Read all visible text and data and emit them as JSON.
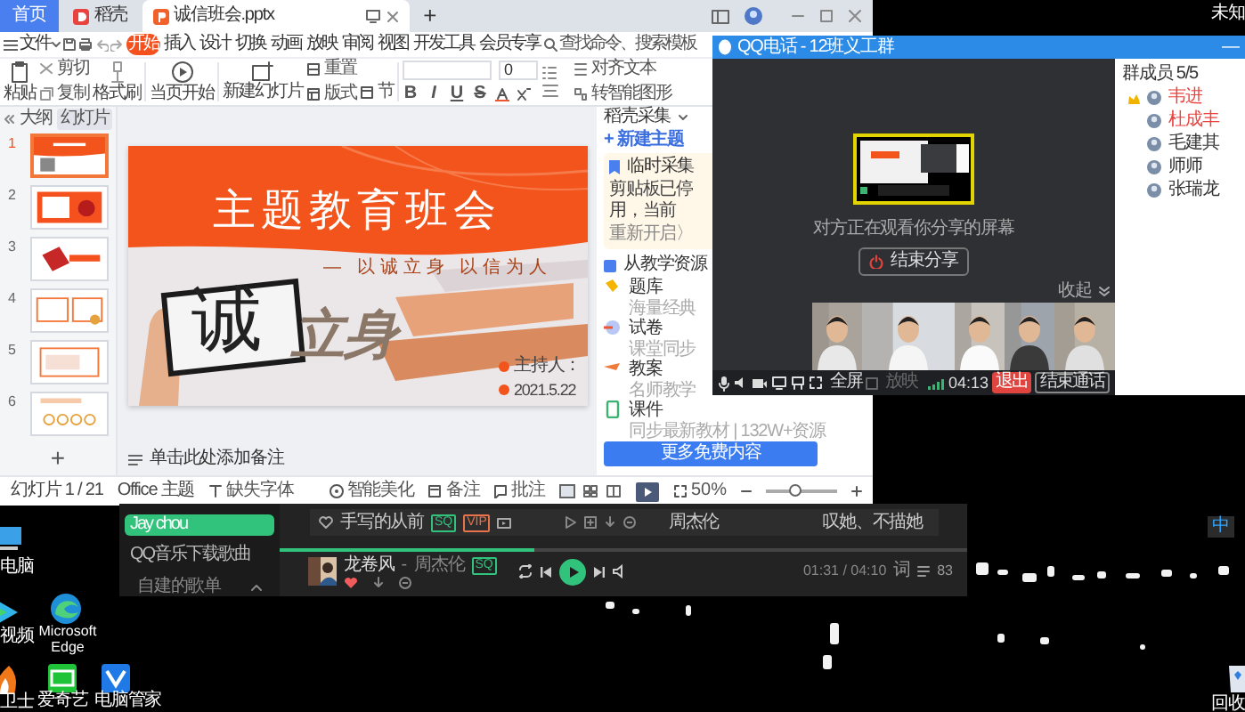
{
  "wps": {
    "tabs": [
      {
        "label": "首页",
        "kind": "home",
        "selected": false
      },
      {
        "label": "稻壳",
        "kind": "docer",
        "selected": false
      },
      {
        "label": "诚信班会.pptx",
        "kind": "file",
        "selected": true
      }
    ],
    "new_tab": "+",
    "file_menu": "文件",
    "menu": [
      {
        "label": "开始",
        "selected": true
      },
      {
        "label": "插入",
        "selected": false
      },
      {
        "label": "设计",
        "selected": false
      },
      {
        "label": "切换",
        "selected": false
      },
      {
        "label": "动画",
        "selected": false
      },
      {
        "label": "放映",
        "selected": false
      },
      {
        "label": "审阅",
        "selected": false
      },
      {
        "label": "视图",
        "selected": false
      },
      {
        "label": "开发工具",
        "selected": false
      },
      {
        "label": "会员专享",
        "selected": false
      }
    ],
    "search": {
      "placeholder": "查找命令、搜索模板"
    },
    "ribbon": {
      "paste": "粘贴",
      "cut": "剪切",
      "copy": "复制",
      "format_painter": "格式刷",
      "play": "当页开始",
      "new_slide": "新建幻灯片",
      "layout": "版式",
      "section": "节",
      "reset": "重置",
      "font_size": "0",
      "format_buttons": [
        "B",
        "I",
        "U",
        "S"
      ],
      "align_text": "对齐文本",
      "smart_graphic": "转智能图形"
    },
    "panel_tabs": [
      {
        "label": "大纲",
        "selected": false
      },
      {
        "label": "幻灯片",
        "selected": true
      }
    ],
    "slides": [
      {
        "number": "1",
        "selected": true
      },
      {
        "number": "2",
        "selected": false
      },
      {
        "number": "3",
        "selected": false
      },
      {
        "number": "4",
        "selected": false
      },
      {
        "number": "5",
        "selected": false
      },
      {
        "number": "6",
        "selected": false
      }
    ],
    "add_slide": "+",
    "slide": {
      "title": "主题教育班会",
      "subtitle": "— 以诚立身 以信为人",
      "big_char": "诚",
      "slogan": "立身",
      "host": "主持人：",
      "date": "2021.5.22"
    },
    "notes_placeholder": "单击此处添加备注",
    "side_panel": {
      "title": "稻壳采集",
      "new_topic": "+ 新建主题",
      "clip_title": "临时采集",
      "clip_text": "剪贴板已停用，当前",
      "clip_action": "重新开启〉",
      "library_title": "从教学资源",
      "items": [
        {
          "title": "题库",
          "desc": "海量经典"
        },
        {
          "title": "试卷",
          "desc": "课堂同步"
        },
        {
          "title": "教案",
          "desc": "名师教学"
        },
        {
          "title": "课件",
          "desc": "同步最新教材 | 132W+资源"
        }
      ],
      "more_button": "更多免费内容"
    },
    "status": {
      "slide_count": "幻灯片 1 / 21",
      "theme": "Office 主题",
      "missing_fonts": "缺失字体",
      "beautify": "智能美化",
      "notes": "备注",
      "comments": "批注",
      "zoom": "50%",
      "zoom_slider": {
        "level": 0.4
      }
    }
  },
  "qq": {
    "title": "QQ电话 - 12班义工群",
    "minimize": "—",
    "status_text": "对方正在观看你分享的屏幕",
    "end_share": "结束分享",
    "collapse": "收起",
    "fullscreen": "全屏",
    "present": {
      "label": "放映",
      "disabled": true
    },
    "timer": "04:13",
    "exit": "退出",
    "end_call": "结束通话",
    "members_title": "群成员 5/5",
    "members": [
      {
        "name": "韦进",
        "owner": true,
        "color": "#e8433e"
      },
      {
        "name": "杜成丰",
        "owner": false,
        "color": "#e8433e"
      },
      {
        "name": "毛建其",
        "owner": false,
        "color": "#333333"
      },
      {
        "name": "师师",
        "owner": false,
        "color": "#333333"
      },
      {
        "name": "张瑞龙",
        "owner": false,
        "color": "#333333"
      }
    ]
  },
  "music": {
    "sidebar": [
      {
        "label": "Jay chou",
        "selected": true
      },
      {
        "label": "QQ音乐下载歌曲",
        "selected": false
      }
    ],
    "section": {
      "label": "自建的歌单",
      "expanded": true
    },
    "song": {
      "title": "手写的从前",
      "tags": [
        {
          "label": "SQ",
          "color": "#31c27c"
        },
        {
          "label": "VIP",
          "color": "#e8734a"
        }
      ],
      "liked": false,
      "artist": "周杰伦",
      "album": "叹她、不描她"
    },
    "progress": {
      "level": 0.37
    },
    "now_playing": {
      "title": "龙卷风",
      "separator": "-",
      "artist": "周杰伦",
      "tags": [
        {
          "label": "SQ",
          "color": "#31c27c"
        }
      ],
      "liked": true
    },
    "time": "01:31 / 04:10",
    "lyrics": "词",
    "queue_count": "83"
  },
  "desktop": {
    "icons": [
      {
        "label": "电脑"
      },
      {
        "label": "视频"
      },
      {
        "label": "Microsoft Edge"
      },
      {
        "label": "卫士"
      },
      {
        "label": "爱奇艺"
      },
      {
        "label": "电脑管家"
      },
      {
        "label": "回收"
      }
    ],
    "ime": "中",
    "corner_text": "未知"
  }
}
